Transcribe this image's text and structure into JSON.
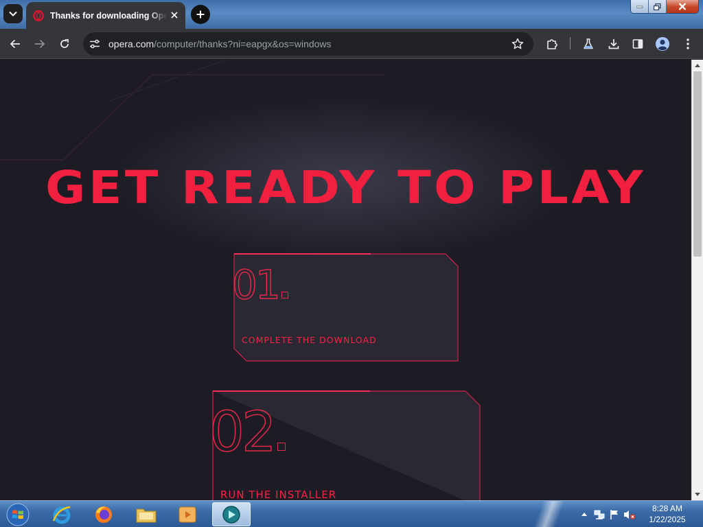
{
  "browser": {
    "tab": {
      "title": "Thanks for downloading Opera GX",
      "favicon": "opera-logo-icon"
    },
    "address": {
      "host": "opera.com",
      "path": "/computer/thanks?ni=eapgx&os=windows"
    },
    "toolbar_icons": [
      "back-arrow-icon",
      "forward-arrow-icon",
      "reload-icon",
      "site-info-icon",
      "bookmark-star-icon",
      "extensions-icon",
      "labs-flask-icon",
      "download-icon",
      "side-panel-icon",
      "profile-icon",
      "menu-icon"
    ]
  },
  "page": {
    "headline": "GET READY TO PLAY",
    "steps": [
      {
        "number": "01",
        "label": "COMPLETE THE DOWNLOAD"
      },
      {
        "number": "02",
        "label": "RUN THE INSTALLER"
      }
    ],
    "accent_color": "#f1203f",
    "background_color": "#1c1b22"
  },
  "taskbar": {
    "apps": [
      "internet-explorer-icon",
      "firefox-icon",
      "file-explorer-icon",
      "media-player-icon",
      "active-app-icon"
    ],
    "tray_icons": [
      "show-hidden-icons-icon",
      "network-icon",
      "action-center-flag-icon",
      "volume-muted-icon"
    ],
    "clock": {
      "time": "8:28 AM",
      "date": "1/22/2025"
    }
  }
}
